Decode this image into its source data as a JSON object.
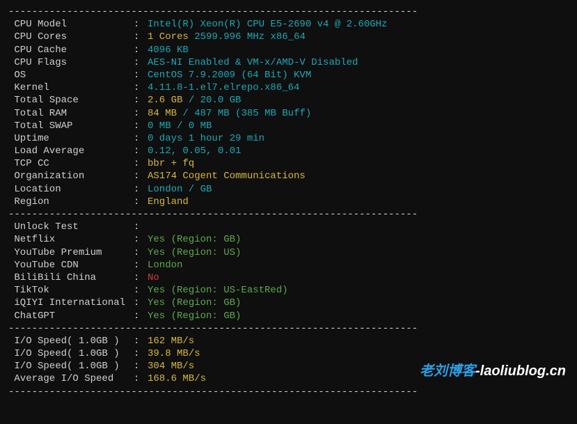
{
  "divider": "----------------------------------------------------------------------",
  "sysinfo": [
    {
      "label": " CPU Model",
      "value": "Intel(R) Xeon(R) CPU E5-2690 v4 @ 2.60GHz",
      "cls": "cyan"
    },
    {
      "label": " CPU Cores",
      "segments": [
        {
          "text": "1 Cores",
          "cls": "yellow"
        },
        {
          "text": " ",
          "cls": "white"
        },
        {
          "text": "2599.996 MHz",
          "cls": "cyan"
        },
        {
          "text": " ",
          "cls": "white"
        },
        {
          "text": "x86_64",
          "cls": "cyan"
        }
      ]
    },
    {
      "label": " CPU Cache",
      "value": "4096 KB",
      "cls": "cyan"
    },
    {
      "label": " CPU Flags",
      "value": "AES-NI Enabled & VM-x/AMD-V Disabled",
      "cls": "cyan"
    },
    {
      "label": " OS",
      "value": "CentOS 7.9.2009 (64 Bit) KVM",
      "cls": "cyan"
    },
    {
      "label": " Kernel",
      "value": "4.11.8-1.el7.elrepo.x86_64",
      "cls": "cyan"
    },
    {
      "label": " Total Space",
      "segments": [
        {
          "text": "2.6 GB",
          "cls": "yellow"
        },
        {
          "text": " / ",
          "cls": "cyan"
        },
        {
          "text": "20.0 GB",
          "cls": "cyan"
        }
      ]
    },
    {
      "label": " Total RAM",
      "segments": [
        {
          "text": "84 MB",
          "cls": "yellow"
        },
        {
          "text": " / ",
          "cls": "cyan"
        },
        {
          "text": "487 MB",
          "cls": "cyan"
        },
        {
          "text": " (385 MB Buff)",
          "cls": "cyan"
        }
      ]
    },
    {
      "label": " Total SWAP",
      "value": "0 MB / 0 MB",
      "cls": "cyan"
    },
    {
      "label": " Uptime",
      "value": "0 days 1 hour 29 min",
      "cls": "cyan"
    },
    {
      "label": " Load Average",
      "value": "0.12, 0.05, 0.01",
      "cls": "cyan"
    },
    {
      "label": " TCP CC",
      "value": "bbr + fq",
      "cls": "yellow"
    },
    {
      "label": " Organization",
      "value": "AS174 Cogent Communications",
      "cls": "yellow"
    },
    {
      "label": " Location",
      "value": "London / GB",
      "cls": "cyan"
    },
    {
      "label": " Region",
      "value": "England",
      "cls": "yellow"
    }
  ],
  "unlock_header": " Unlock Test",
  "unlock": [
    {
      "label": " Netflix",
      "value": "Yes (Region: GB)",
      "cls": "green"
    },
    {
      "label": " YouTube Premium",
      "value": "Yes (Region: US)",
      "cls": "green"
    },
    {
      "label": " YouTube CDN",
      "value": "London",
      "cls": "green"
    },
    {
      "label": " BiliBili China",
      "value": "No",
      "cls": "red"
    },
    {
      "label": " TikTok",
      "value": "Yes (Region: US-EastRed)",
      "cls": "green"
    },
    {
      "label": " iQIYI International",
      "value": "Yes (Region: GB)",
      "cls": "green"
    },
    {
      "label": " ChatGPT",
      "value": "Yes (Region: GB)",
      "cls": "green"
    }
  ],
  "io": [
    {
      "label": " I/O Speed( 1.0GB )",
      "value": "162 MB/s",
      "cls": "yellow"
    },
    {
      "label": " I/O Speed( 1.0GB )",
      "value": "39.8 MB/s",
      "cls": "yellow"
    },
    {
      "label": " I/O Speed( 1.0GB )",
      "value": "304 MB/s",
      "cls": "yellow"
    },
    {
      "label": " Average I/O Speed",
      "value": "168.6 MB/s",
      "cls": "yellow"
    }
  ],
  "watermark": {
    "cn": "老刘博客",
    "en": "-laoliublog.cn"
  }
}
